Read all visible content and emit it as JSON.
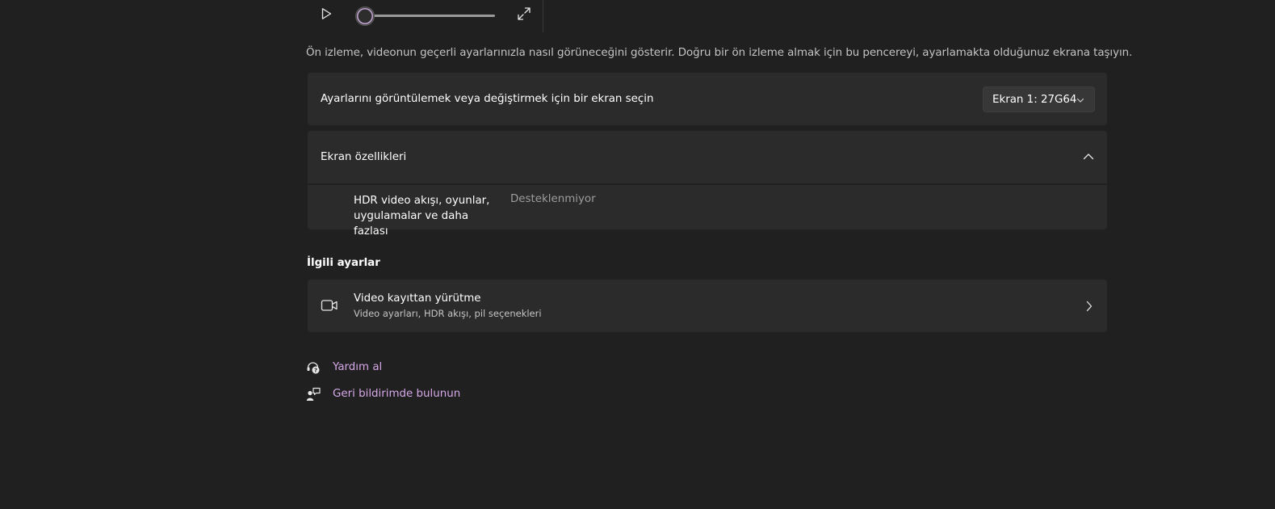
{
  "preview": {
    "play_icon": "play-icon",
    "expand_icon": "expand-icon",
    "slider_value": 0,
    "note": "Ön izleme, videonun geçerli ayarlarınızla nasıl görüneceğini gösterir. Doğru bir ön izleme almak için bu pencereyi, ayarlamakta olduğunuz ekrana taşıyın."
  },
  "display_select": {
    "label": "Ayarlarını görüntülemek veya değiştirmek için bir ekran seçin",
    "selected": "Ekran 1: 27G64",
    "chevron_icon": "chevron-down-icon"
  },
  "display_properties": {
    "title": "Ekran özellikleri",
    "expanded": true,
    "chevron_icon": "chevron-up-icon",
    "items": [
      {
        "name": "HDR video akışı, oyunlar, uygulamalar ve daha fazlası",
        "value": "Desteklenmiyor"
      }
    ]
  },
  "related": {
    "title": "İlgili ayarlar",
    "items": [
      {
        "icon": "video-camera-icon",
        "title": "Video kayıttan yürütme",
        "description": "Video ayarları, HDR akışı, pil seçenekleri"
      }
    ]
  },
  "links": [
    {
      "icon": "help-icon",
      "label": "Yardım al"
    },
    {
      "icon": "feedback-icon",
      "label": "Geri bildirimde bulunun"
    }
  ],
  "colors": {
    "background": "#202020",
    "card": "#2b2b2b",
    "accent": "#d6a9e8",
    "secondary_text": "#9d9d9d"
  }
}
